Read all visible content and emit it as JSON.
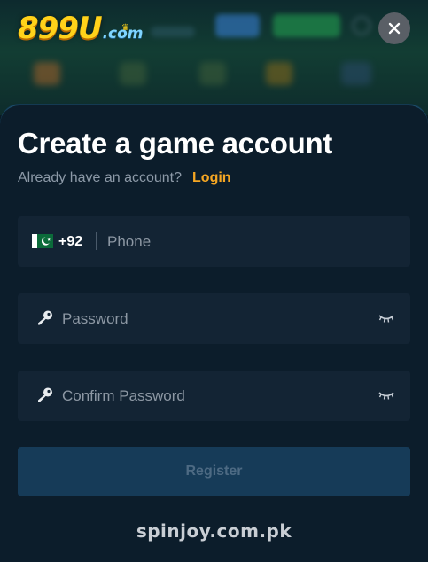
{
  "brand": {
    "logo_main": "899U",
    "logo_sub": ".com"
  },
  "modal": {
    "title": "Create a game account",
    "already_text": "Already have an account?",
    "login_label": "Login"
  },
  "form": {
    "phone": {
      "country_flag": "pakistan-flag-icon",
      "dial_code": "+92",
      "placeholder": "Phone",
      "value": ""
    },
    "password": {
      "placeholder": "Password",
      "value": ""
    },
    "confirm_password": {
      "placeholder": "Confirm Password",
      "value": ""
    },
    "register_label": "Register"
  },
  "watermark": "spinjoy.com.pk",
  "colors": {
    "accent": "#f5a623",
    "panel_bg": "#0c1d2b",
    "field_bg": "#132434",
    "register_bg": "#163b58"
  }
}
